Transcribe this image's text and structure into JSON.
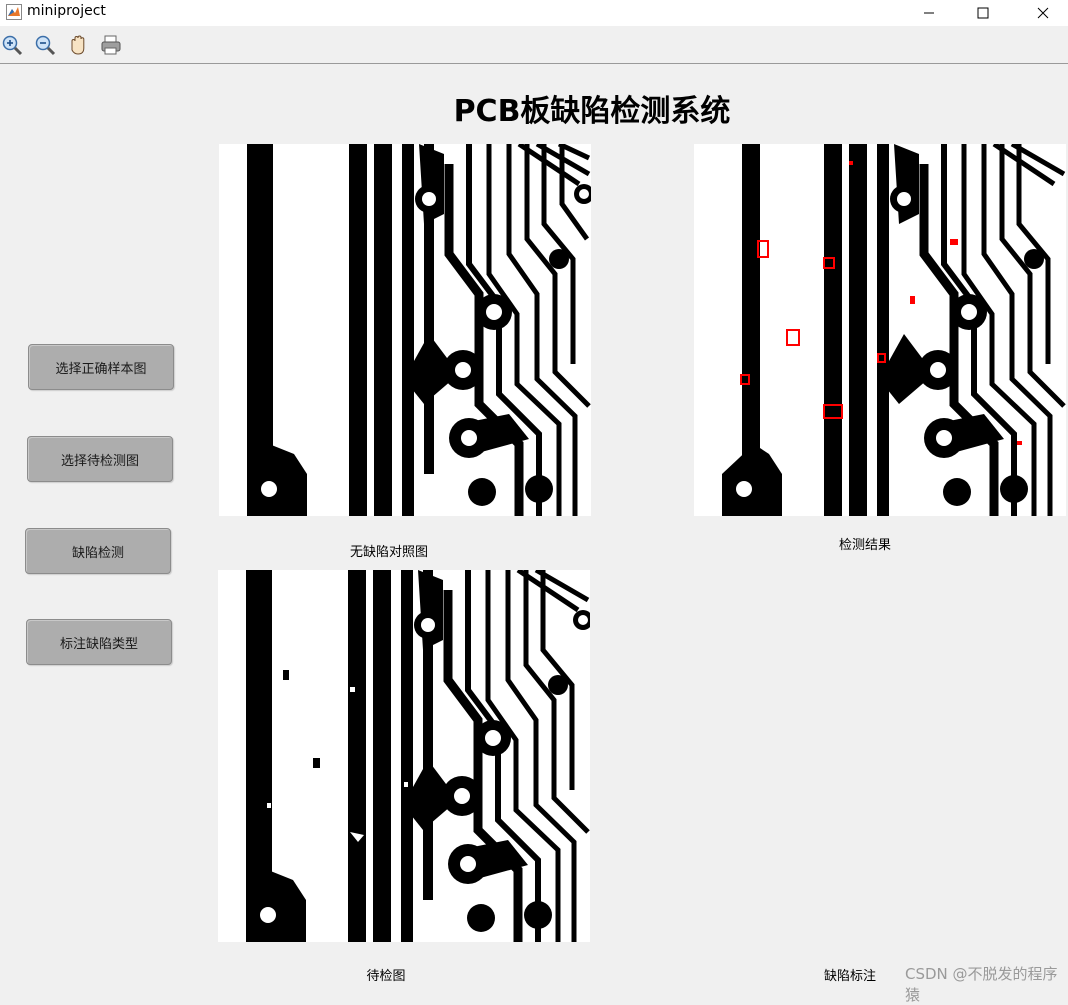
{
  "window": {
    "title": "miniproject"
  },
  "toolbar": {
    "icons": [
      "zoom-in-icon",
      "zoom-out-icon",
      "pan-hand-icon",
      "print-icon"
    ]
  },
  "header": {
    "title": "PCB板缺陷检测系统"
  },
  "buttons": {
    "select_reference": "选择正确样本图",
    "select_test": "选择待检测图",
    "detect": "缺陷检测",
    "label_types": "标注缺陷类型"
  },
  "panels": {
    "reference_caption": "无缺陷对照图",
    "result_caption": "检测结果",
    "test_caption": "待检图",
    "annotation_caption": "缺陷标注"
  },
  "watermark": "CSDN @不脱发的程序猿",
  "colors": {
    "accent": "#ff0000",
    "button": "#adadad",
    "background": "#f0f0f0"
  }
}
